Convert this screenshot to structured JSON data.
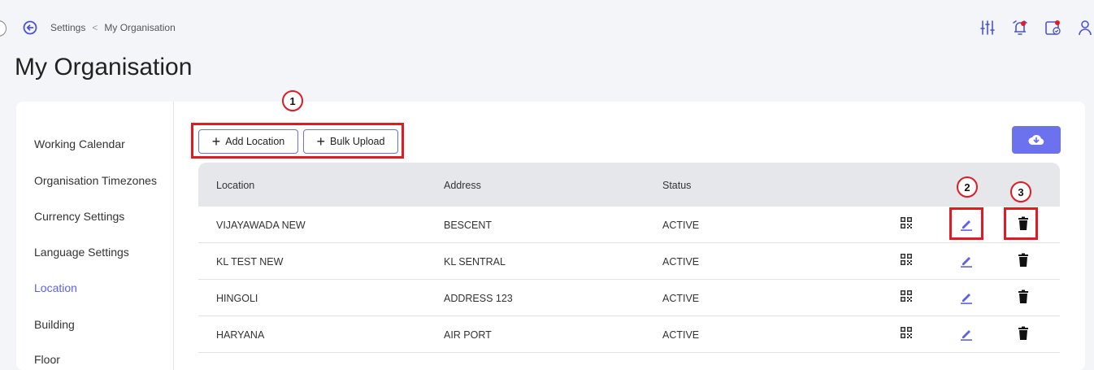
{
  "breadcrumb": {
    "parent": "Settings",
    "separator": "<",
    "current": "My Organisation"
  },
  "page_title": "My Organisation",
  "sidebar": {
    "items": [
      {
        "label": "Working Calendar",
        "active": false
      },
      {
        "label": "Organisation Timezones",
        "active": false
      },
      {
        "label": "Currency Settings",
        "active": false
      },
      {
        "label": "Language Settings",
        "active": false
      },
      {
        "label": "Location",
        "active": true
      },
      {
        "label": "Building",
        "active": false
      },
      {
        "label": "Floor",
        "active": false
      }
    ]
  },
  "toolbar": {
    "add_location_label": "Add Location",
    "bulk_upload_label": "Bulk Upload"
  },
  "callouts": [
    "1",
    "2",
    "3"
  ],
  "table": {
    "headers": {
      "location": "Location",
      "address": "Address",
      "status": "Status"
    },
    "rows": [
      {
        "location": "VIJAYAWADA NEW",
        "address": "BESCENT",
        "status": "ACTIVE"
      },
      {
        "location": "KL TEST NEW",
        "address": "KL SENTRAL",
        "status": "ACTIVE"
      },
      {
        "location": "HINGOLI",
        "address": "ADDRESS 123",
        "status": "ACTIVE"
      },
      {
        "location": "HARYANA",
        "address": "AIR PORT",
        "status": "ACTIVE"
      }
    ]
  },
  "icons": {
    "back": "back-arrow-circle-icon",
    "top": [
      "filter-sliders-icon",
      "alarm-bell-icon",
      "calendar-check-icon",
      "user-icon"
    ],
    "download": "cloud-download-icon",
    "row_actions": [
      "qr-code-icon",
      "edit-pencil-icon",
      "delete-trash-icon"
    ]
  },
  "colors": {
    "accent": "#5b62e6",
    "highlight": "#e01b24",
    "table_header": "#e6e7eb",
    "notification": "#e01b24"
  }
}
